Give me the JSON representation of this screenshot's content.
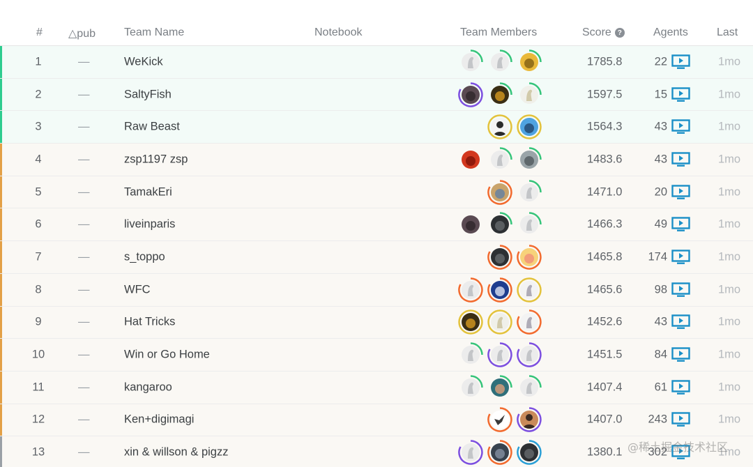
{
  "columns": {
    "rank": "#",
    "delta_pub": "△pub",
    "team_name": "Team Name",
    "notebook": "Notebook",
    "team_members": "Team Members",
    "score": "Score",
    "agents": "Agents",
    "last": "Last"
  },
  "colors": {
    "gold_bar": "#2ecc8f",
    "silver_bar": "#e3a046",
    "bronze_bar": "#9aa0a6",
    "agent_icon": "#1a8fc7",
    "ring_green": "#35c47a",
    "ring_orange": "#f26a2e",
    "ring_purple": "#7c4fe0",
    "ring_gold": "#e3c23b",
    "ring_blue": "#2a9fd6"
  },
  "rows": [
    {
      "rank": "1",
      "delta": "—",
      "team": "WeKick",
      "score": "1785.8",
      "agents": "22",
      "last": "1mo",
      "tier": "gold",
      "members": [
        {
          "ring": "green",
          "pic": "ghost"
        },
        {
          "ring": "green",
          "pic": "ghost"
        },
        {
          "ring": "green",
          "pic": "gold"
        }
      ]
    },
    {
      "rank": "2",
      "delta": "—",
      "team": "SaltyFish",
      "score": "1597.5",
      "agents": "15",
      "last": "1mo",
      "tier": "gold",
      "members": [
        {
          "ring": "purple",
          "pic": "dark"
        },
        {
          "ring": "green",
          "pic": "amber"
        },
        {
          "ring": "green",
          "pic": "leaf"
        }
      ]
    },
    {
      "rank": "3",
      "delta": "—",
      "team": "Raw Beast",
      "score": "1564.3",
      "agents": "43",
      "last": "1mo",
      "tier": "gold",
      "members": [
        {
          "ring": "goldfull",
          "pic": "person"
        },
        {
          "ring": "goldfull",
          "pic": "blue"
        }
      ]
    },
    {
      "rank": "4",
      "delta": "—",
      "team": "zsp1197 zsp",
      "score": "1483.6",
      "agents": "43",
      "last": "1mo",
      "tier": "silver",
      "members": [
        {
          "ring": "none",
          "pic": "red"
        },
        {
          "ring": "green",
          "pic": "ghost"
        },
        {
          "ring": "green",
          "pic": "grey"
        }
      ]
    },
    {
      "rank": "5",
      "delta": "—",
      "team": "TamakEri",
      "score": "1471.0",
      "agents": "20",
      "last": "1mo",
      "tier": "silver",
      "members": [
        {
          "ring": "orange",
          "pic": "city"
        },
        {
          "ring": "green",
          "pic": "ghost"
        }
      ]
    },
    {
      "rank": "6",
      "delta": "—",
      "team": "liveinparis",
      "score": "1466.3",
      "agents": "49",
      "last": "1mo",
      "tier": "silver",
      "members": [
        {
          "ring": "none",
          "pic": "dark"
        },
        {
          "ring": "green",
          "pic": "dark2"
        },
        {
          "ring": "green",
          "pic": "ghost"
        }
      ]
    },
    {
      "rank": "7",
      "delta": "—",
      "team": "s_toppo",
      "score": "1465.8",
      "agents": "174",
      "last": "1mo",
      "tier": "silver",
      "members": [
        {
          "ring": "orange",
          "pic": "dark2"
        },
        {
          "ring": "orange",
          "pic": "anime"
        }
      ]
    },
    {
      "rank": "8",
      "delta": "—",
      "team": "WFC",
      "score": "1465.6",
      "agents": "98",
      "last": "1mo",
      "tier": "silver",
      "members": [
        {
          "ring": "orange",
          "pic": "ghost"
        },
        {
          "ring": "orange",
          "pic": "navy"
        },
        {
          "ring": "goldfull",
          "pic": "sketch"
        }
      ]
    },
    {
      "rank": "9",
      "delta": "—",
      "team": "Hat Tricks",
      "score": "1452.6",
      "agents": "43",
      "last": "1mo",
      "tier": "silver",
      "members": [
        {
          "ring": "goldfull",
          "pic": "amber"
        },
        {
          "ring": "goldfull",
          "pic": "leaf"
        },
        {
          "ring": "orange",
          "pic": "sketch"
        }
      ]
    },
    {
      "rank": "10",
      "delta": "—",
      "team": "Win or Go Home",
      "score": "1451.5",
      "agents": "84",
      "last": "1mo",
      "tier": "silver",
      "members": [
        {
          "ring": "green",
          "pic": "ghost"
        },
        {
          "ring": "purple",
          "pic": "ghost"
        },
        {
          "ring": "purple",
          "pic": "ghost"
        }
      ]
    },
    {
      "rank": "11",
      "delta": "—",
      "team": "kangaroo",
      "score": "1407.4",
      "agents": "61",
      "last": "1mo",
      "tier": "silver",
      "members": [
        {
          "ring": "green",
          "pic": "ghost"
        },
        {
          "ring": "green",
          "pic": "teal"
        },
        {
          "ring": "green",
          "pic": "ghost"
        }
      ]
    },
    {
      "rank": "12",
      "delta": "—",
      "team": "Ken+digimagi",
      "score": "1407.0",
      "agents": "243",
      "last": "1mo",
      "tier": "silver",
      "members": [
        {
          "ring": "orange",
          "pic": "bird"
        },
        {
          "ring": "purple",
          "pic": "face"
        }
      ]
    },
    {
      "rank": "13",
      "delta": "—",
      "team": "xin & willson & pigzz",
      "score": "1380.1",
      "agents": "302",
      "last": "1mo",
      "tier": "bronze",
      "members": [
        {
          "ring": "purple",
          "pic": "ghost"
        },
        {
          "ring": "orange",
          "pic": "navy2"
        },
        {
          "ring": "blue",
          "pic": "dark2"
        }
      ]
    }
  ],
  "watermark": "@稀土掘金技术社区"
}
